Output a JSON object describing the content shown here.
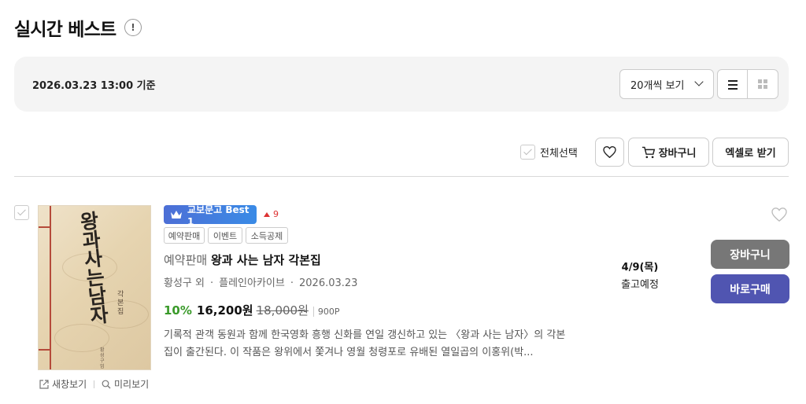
{
  "header": {
    "title": "실시간 베스트",
    "info_glyph": "!"
  },
  "filter": {
    "timestamp": "2026.03.23 13:00 기준",
    "per_page": "20개씩 보기",
    "view_modes": [
      "list",
      "grid"
    ]
  },
  "toolbar": {
    "select_all": "전체선택",
    "cart": "장바구니",
    "excel": "엑셀로 받기"
  },
  "item": {
    "rank_badge": "교보문고 Best 1",
    "rank_change": "9",
    "tags": [
      "예약판매",
      "이벤트",
      "소득공제"
    ],
    "prefix": "예약판매",
    "title": "왕과 사는 남자 각본집",
    "author": "황성구 외",
    "publisher": "플레인아카이브",
    "date": "2026.03.23",
    "discount": "10%",
    "price": "16,200원",
    "original_price": "18,000원",
    "points": "900P",
    "description": "기록적 관객 동원과 함께 한국영화 흥행 신화를 연일 갱신하고 있는 〈왕과 사는 남자〉의 각본집이 출간된다. 이 작품은 왕위에서 쫓겨나 영월 청령포로 유배된 열일곱의 이홍위(박...",
    "ship_date": "4/9(목)",
    "ship_label": "출고예정",
    "cart_button": "장바구니",
    "buy_button": "바로구매",
    "new_window": "새창보기",
    "preview": "미리보기",
    "cover": {
      "calligraphy": "왕과사는남자",
      "subtitle": "각본집",
      "authors": "황성구 엄한길"
    }
  },
  "colors": {
    "accent": "#5055b1",
    "cart_bg": "#777777",
    "discount": "#3a9a2a",
    "rank_up": "#dd3333",
    "badge": "#3a8be6"
  },
  "icons": [
    "info-icon",
    "chevron-down-icon",
    "list-view-icon",
    "grid-view-icon",
    "heart-icon",
    "cart-icon",
    "checkbox-icon",
    "crown-icon",
    "external-link-icon",
    "search-icon",
    "triangle-up-icon"
  ]
}
